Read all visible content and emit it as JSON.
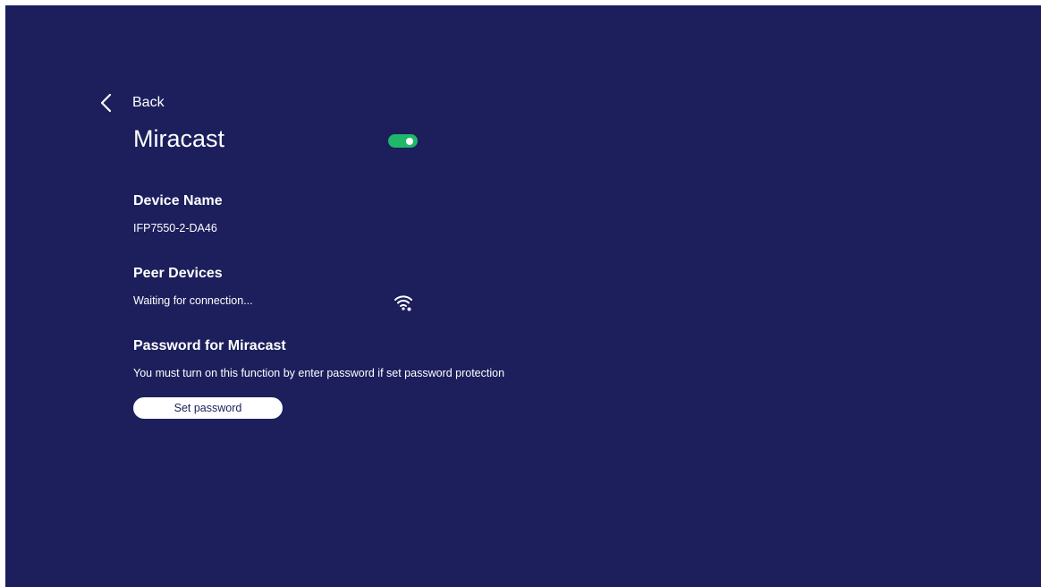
{
  "header": {
    "back_label": "Back",
    "back_icon": "chevron-left-icon"
  },
  "miracast": {
    "title": "Miracast",
    "toggle_state": "on",
    "toggle_color": "#1fb86a"
  },
  "device_name": {
    "heading": "Device Name",
    "value": "IFP7550-2-DA46"
  },
  "peer_devices": {
    "heading": "Peer Devices",
    "status": "Waiting for connection...",
    "status_icon": "wifi-searching-icon"
  },
  "password": {
    "heading": "Password for Miracast",
    "description": "You must turn on this function by enter password if set password protection",
    "button_label": "Set password"
  },
  "colors": {
    "background": "#1c1f5c",
    "text": "#ffffff",
    "accent": "#1fb86a"
  }
}
